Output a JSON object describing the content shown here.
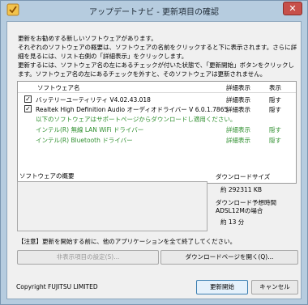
{
  "window": {
    "title": "アップデートナビ - 更新項目の確認",
    "close_glyph": "✕"
  },
  "intro": {
    "line1": "更新をお勧めする新しいソフトウェアがあります。",
    "line2": "それぞれのソフトウェアの概要は、ソフトウェアの名前をクリックすると下に表示されます。さらに詳細を見るには、リスト右側の「詳細表示」をクリックします。",
    "line3": "更新するには、ソフトウェア名の左にあるチェックが付いた状態で、「更新開始」ボタンをクリックします。ソフトウェア名の左にあるチェックを外すと、そのソフトウェアは更新されません。"
  },
  "list": {
    "headers": {
      "name": "ソフトウェア名",
      "detail": "詳細表示",
      "hide": "表示"
    },
    "rows": [
      {
        "checked": true,
        "check_glyph": "✓",
        "name": "バッテリーユーティリティ V4.02.43.018",
        "detail": "詳細表示",
        "hide": "隠す"
      },
      {
        "checked": true,
        "check_glyph": "✓",
        "name": "Realtek High Definition Audio オーディオドライバー V 6.0.1.7865",
        "detail": "詳細表示",
        "hide": "隠す"
      }
    ],
    "support_note": "以下のソフトウェアはサポートページからダウンロードし適用ください。",
    "support_rows": [
      {
        "name": "インテル(R) 無線 LAN WiFi ドライバー",
        "detail": "詳細表示",
        "hide": "隠す"
      },
      {
        "name": "インテル(R) Bluetooth ドライバー",
        "detail": "詳細表示",
        "hide": "隠す"
      }
    ]
  },
  "summary": {
    "label": "ソフトウェアの概要"
  },
  "download": {
    "size_label": "ダウンロードサイズ",
    "size_value": "約 292311 KB",
    "time_label": "ダウンロード予想時間",
    "time_condition": "ADSL12Mの場合",
    "time_value": "約 13 分"
  },
  "notice": "【注意】更新を開始する前に、他のアプリケーションを全て終了してください。",
  "buttons": {
    "hidden_settings": "非表示項目の設定(S)...",
    "open_download": "ダウンロードページを開く(Q)...",
    "start_update": "更新開始",
    "cancel": "キャンセル"
  },
  "footer": {
    "copyright": "Copyright FUJITSU LIMITED"
  },
  "colors": {
    "support_text": "#2f8f2f",
    "frame": "#b6ccdf",
    "close_button": "#c7504a"
  }
}
